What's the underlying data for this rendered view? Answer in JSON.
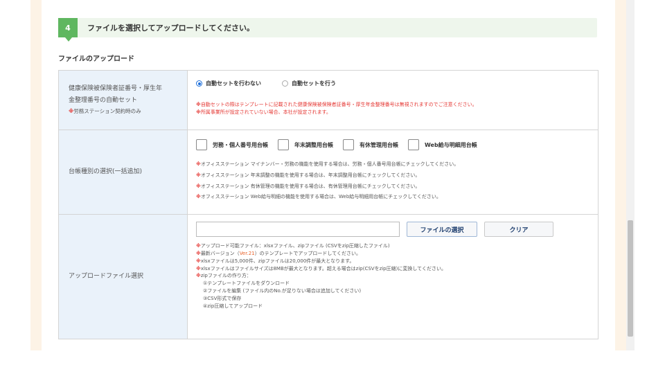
{
  "step": {
    "number": "4",
    "title": "ファイルを選択してアップロードしてください。"
  },
  "section_title": "ファイルのアップロード",
  "rows": [
    {
      "label_lines": [
        "健康保険被保険者証番号・厚生年",
        "金整理番号の自動セット"
      ],
      "sub_mark": "※",
      "sub_text": "労務ステーション契約時のみ",
      "radios": [
        {
          "label": "自動セットを行わない",
          "selected": true
        },
        {
          "label": "自動セットを行う",
          "selected": false
        }
      ],
      "notes": [
        {
          "mark": "※",
          "text": "自動セットの際はテンプレートに記載された健康保険被保険者証番号・厚生年金整理番号は無視されますのでご注意ください。"
        },
        {
          "mark": "※",
          "text": "所属事業所が設定されていない場合、本社が設定されます。"
        }
      ]
    },
    {
      "label": "台帳種別の選択(一括追加)",
      "checkboxes": [
        {
          "label": "労務・個人番号用台帳",
          "checked": false
        },
        {
          "label": "年末調整用台帳",
          "checked": false
        },
        {
          "label": "有休管理用台帳",
          "checked": false
        },
        {
          "label": "Web給与明細用台帳",
          "checked": false
        }
      ],
      "notes": [
        {
          "mark": "※",
          "text": "オフィスステーション マイナンバー・労務の機能を使用する場合は、労務・個人番号用台帳にチェックしてください。"
        },
        {
          "mark": "※",
          "text": "オフィスステーション 年末調整の機能を使用する場合は、年末調整用台帳にチェックしてください。"
        },
        {
          "mark": "※",
          "text": "オフィスステーション 有休管理の機能を使用する場合は、有休管理用台帳にチェックしてください。"
        },
        {
          "mark": "※",
          "text": "オフィスステーション Web給与明細の機能を使用する場合は、Web給与明細用台帳にチェックしてください。"
        }
      ]
    },
    {
      "label": "アップロードファイル選択",
      "file_input_value": "",
      "select_button": "ファイルの選択",
      "clear_button": "クリア",
      "notes": [
        {
          "mark": "※",
          "text": "アップロード可能ファイル：xlsxファイル、zipファイル (CSVをzip圧縮したファイル)"
        },
        {
          "mark": "※",
          "pre": "最新バージョン（",
          "link": "Ver.21",
          "post": "）のテンプレートでアップロードしてください。"
        },
        {
          "mark": "※",
          "text": "xlsxファイルは5,000件、zipファイルは20,000件が最大となります。"
        },
        {
          "mark": "※",
          "text": "xlsxファイルはファイルサイズは8MBが最大となります。超える場合はzip(CSVをzip圧縮)に変換してください。"
        },
        {
          "mark": "※",
          "text": "zipファイルの作り方："
        }
      ],
      "steps": [
        "①テンプレートファイルをダウンロード",
        "②ファイルを編集 (ファイル内のNo.が足りない場合は追加してください)",
        "③CSV形式で保存",
        "④zip圧縮してアップロード"
      ]
    }
  ]
}
